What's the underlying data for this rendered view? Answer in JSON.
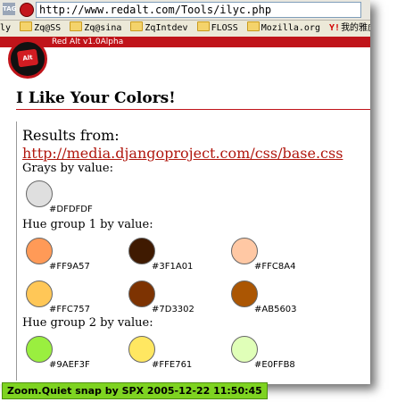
{
  "browser": {
    "url": "http://www.redalt.com/Tools/ilyc.php",
    "tag_label": "TAG",
    "bookmarks": [
      "ly",
      "Zq@SS",
      "Zq@sina",
      "ZqIntdev",
      "FLOSS",
      "Mozilla.org",
      "我的雅虎",
      "SV"
    ]
  },
  "site": {
    "bar_text": "Red Alt v1.0Alpha",
    "logo_text": "Alt"
  },
  "page": {
    "title": "I Like Your Colors!",
    "results_label": "Results from:",
    "source_url": "http://media.djangoproject.com/css/base.css",
    "groups": [
      {
        "label": "Grays by value:",
        "colors": [
          "#DFDFDF"
        ]
      },
      {
        "label": "Hue group 1 by value:",
        "colors": [
          "#FF9A57",
          "#3F1A01",
          "#FFC8A4",
          "#FFC757",
          "#7D3302",
          "#AB5603"
        ]
      },
      {
        "label": "Hue group 2 by value:",
        "colors": [
          "#9AEF3F",
          "#FFE761",
          "#E0FFB8"
        ]
      }
    ]
  },
  "watermark": "Zoom.Quiet snap by SPX 2005-12-22  11:50:45"
}
